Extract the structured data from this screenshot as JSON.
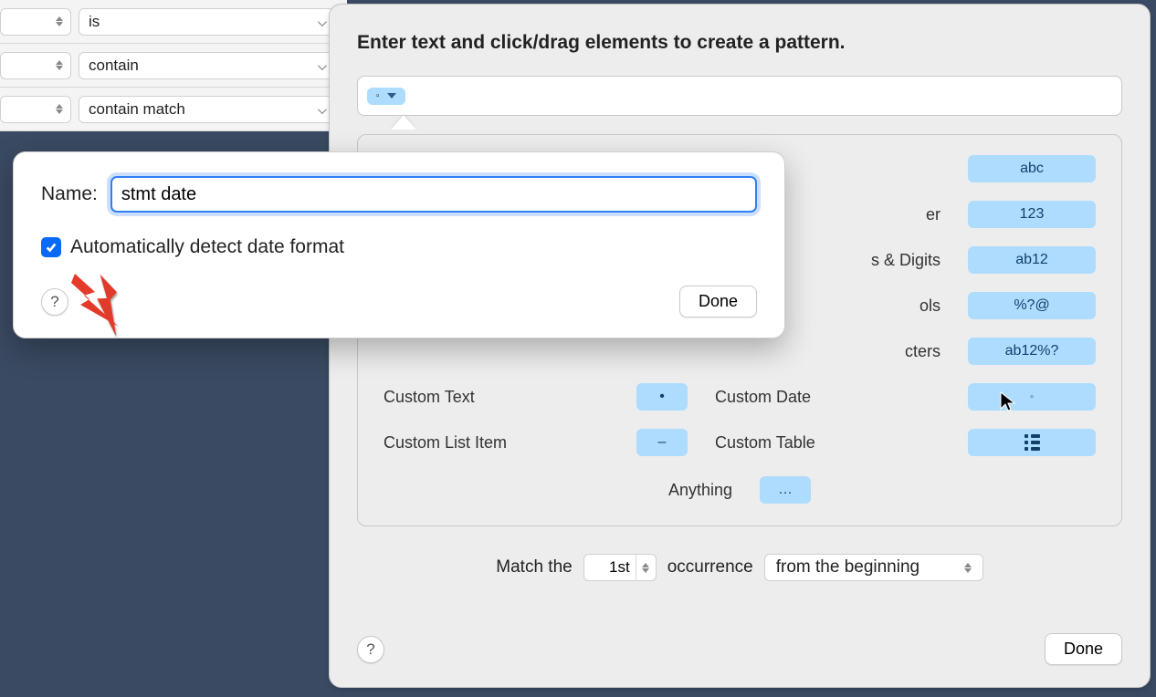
{
  "rules": [
    {
      "verb": "is"
    },
    {
      "verb": "contain"
    },
    {
      "verb": "contain match"
    }
  ],
  "panel": {
    "title": "Enter text and click/drag elements to create a pattern.",
    "token_symbol": "▫",
    "categories": {
      "row1": {
        "right_label_suffix": "er",
        "right_pill": "123",
        "left_pill": "abc"
      },
      "row2": {
        "right_label_suffix": "s & Digits",
        "right_pill": "ab12"
      },
      "row3": {
        "right_label_suffix": "ols",
        "right_pill": "%?@"
      },
      "row4": {
        "right_label_suffix": "cters",
        "right_pill": "ab12%?"
      },
      "custom_text": "Custom Text",
      "custom_text_pill": "•",
      "custom_date": "Custom Date",
      "custom_date_pill": "▫",
      "custom_list": "Custom List Item",
      "custom_list_pill": "–",
      "custom_table": "Custom Table",
      "anything": "Anything",
      "anything_pill": "…"
    },
    "match": {
      "prefix": "Match the",
      "nth": "1st",
      "occurrence": "occurrence",
      "from": "from the beginning"
    },
    "done": "Done",
    "help": "?"
  },
  "popover": {
    "name_label": "Name:",
    "name_value": "stmt date",
    "auto_detect": "Automatically detect date format",
    "done": "Done",
    "help": "?"
  }
}
